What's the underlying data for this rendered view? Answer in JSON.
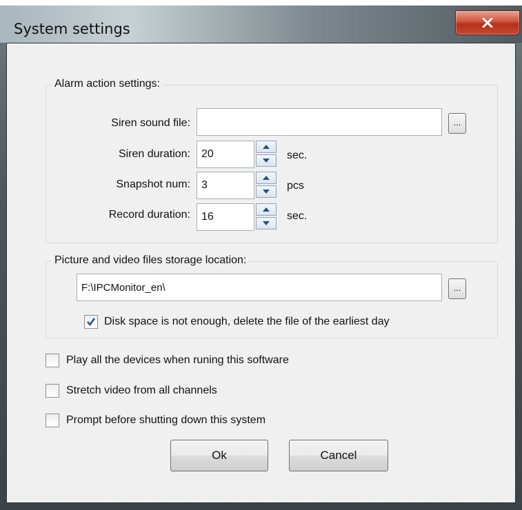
{
  "window": {
    "title": "System settings",
    "close_icon": "close-x-icon"
  },
  "alarm": {
    "group_title": "Alarm action settings:",
    "siren_file_label": "Siren sound file:",
    "siren_file_value": "",
    "browse_label": "...",
    "siren_duration_label": "Siren duration:",
    "siren_duration_value": "20",
    "siren_duration_unit": "sec.",
    "snapshot_label": "Snapshot num:",
    "snapshot_value": "3",
    "snapshot_unit": "pcs",
    "record_label": "Record duration:",
    "record_value": "16",
    "record_unit": "sec."
  },
  "storage": {
    "group_title": "Picture and video files storage location:",
    "path_value": "F:\\IPCMonitor_en\\",
    "browse_label": "...",
    "delete_oldest_label": "Disk space is not enough, delete the file of the earliest day",
    "delete_oldest_checked": true
  },
  "options": [
    {
      "label": "Play all the devices when runing this software",
      "checked": false
    },
    {
      "label": "Stretch video from all channels",
      "checked": false
    },
    {
      "label": "Prompt before shutting down this system",
      "checked": false
    }
  ],
  "buttons": {
    "ok": "Ok",
    "cancel": "Cancel"
  },
  "colors": {
    "close_button": "#c9462e",
    "checkmark": "#2a4f8f",
    "dialog_bg": "#f0f0f0"
  }
}
